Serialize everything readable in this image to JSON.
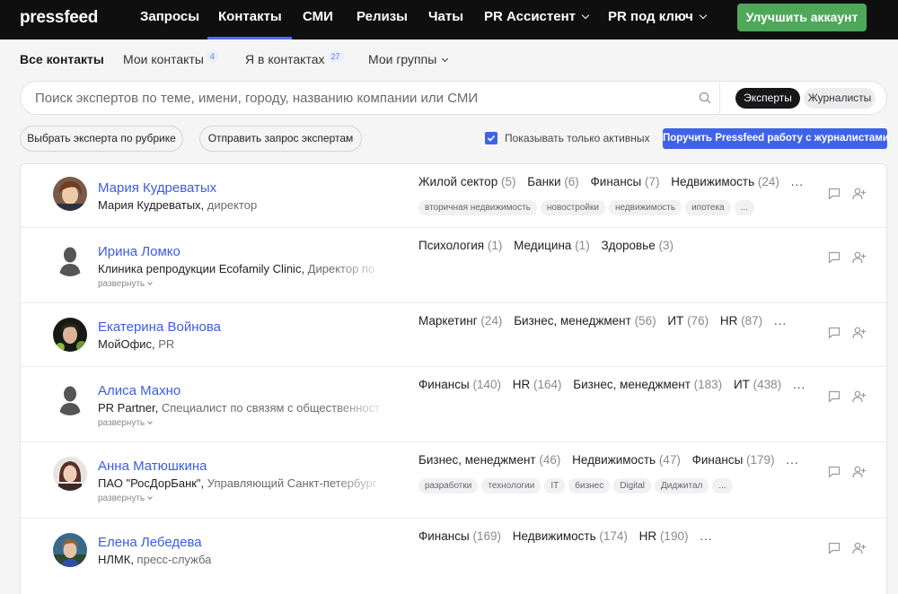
{
  "app": {
    "logo": "pressfeed",
    "nav": [
      {
        "label": "Запросы"
      },
      {
        "label": "Контакты"
      },
      {
        "label": "СМИ"
      },
      {
        "label": "Релизы"
      },
      {
        "label": "Чаты"
      },
      {
        "label": "PR Ассистент"
      },
      {
        "label": "PR под ключ"
      }
    ],
    "upgrade_label": "Улучшить аккаунт"
  },
  "subtabs": [
    {
      "label": "Все контакты",
      "count": ""
    },
    {
      "label": "Мои контакты",
      "count": "4"
    },
    {
      "label": "Я в контактах",
      "count": "27"
    },
    {
      "label": "Мои группы",
      "count": ""
    }
  ],
  "search": {
    "placeholder": "Поиск экспертов по теме, имени, городу, названию компании или СМИ",
    "toggle_on": "Эксперты",
    "toggle_off": "Журналисты"
  },
  "actions": {
    "by_rubric": "Выбрать эксперта по рубрике",
    "send_request": "Отправить запрос экспертам",
    "only_active": "Показывать только активных",
    "cta": "Поручить Pressfeed работу с журналистами"
  },
  "experts": [
    {
      "name": "Мария Кудреватых",
      "company": "Мария Кудреватых, ",
      "position": "директор",
      "expand": "",
      "categories": [
        {
          "label": "Жилой сектор",
          "n": "(5)"
        },
        {
          "label": "Банки",
          "n": "(6)"
        },
        {
          "label": "Финансы",
          "n": "(7)"
        },
        {
          "label": "Недвижимость",
          "n": "(24)"
        }
      ],
      "more": "...",
      "tags": [
        "вторичная недвижимость",
        "новостройки",
        "недвижимость",
        "ипотека",
        "..."
      ]
    },
    {
      "name": "Ирина Ломко",
      "company": "Клиника репродукции Ecofamily Clinic, ",
      "position": "Директор по",
      "expand": "развернуть",
      "categories": [
        {
          "label": "Психология",
          "n": "(1)"
        },
        {
          "label": "Медицина",
          "n": "(1)"
        },
        {
          "label": "Здоровье",
          "n": "(3)"
        }
      ],
      "more": "",
      "tags": []
    },
    {
      "name": "Екатерина Войнова",
      "company": "МойОфис, ",
      "position": "PR",
      "expand": "",
      "categories": [
        {
          "label": "Маркетинг",
          "n": "(24)"
        },
        {
          "label": "Бизнес, менеджмент",
          "n": "(56)"
        },
        {
          "label": "ИТ",
          "n": "(76)"
        },
        {
          "label": "HR",
          "n": "(87)"
        }
      ],
      "more": "...",
      "tags": []
    },
    {
      "name": "Алиса Махно",
      "company": "PR Partner, ",
      "position": "Специалист по связям с общественност",
      "expand": "развернуть",
      "categories": [
        {
          "label": "Финансы",
          "n": "(140)"
        },
        {
          "label": "HR",
          "n": "(164)"
        },
        {
          "label": "Бизнес, менеджмент",
          "n": "(183)"
        },
        {
          "label": "ИТ",
          "n": "(438)"
        }
      ],
      "more": "...",
      "tags": []
    },
    {
      "name": "Анна Матюшкина",
      "company": "ПАО \"РосДорБанк\", ",
      "position": "Управляющий Санкт-петербург",
      "expand": "развернуть",
      "categories": [
        {
          "label": "Бизнес, менеджмент",
          "n": "(46)"
        },
        {
          "label": "Недвижимость",
          "n": "(47)"
        },
        {
          "label": "Финансы",
          "n": "(179)"
        }
      ],
      "more": "...",
      "tags": [
        "разработки",
        "технологии",
        "IT",
        "бизнес",
        "Digital",
        "Диджитал",
        "..."
      ]
    },
    {
      "name": "Елена Лебедева",
      "company": "НЛМК, ",
      "position": "пресс-служба",
      "expand": "",
      "categories": [
        {
          "label": "Финансы",
          "n": "(169)"
        },
        {
          "label": "Недвижимость",
          "n": "(174)"
        },
        {
          "label": "HR",
          "n": "(190)"
        }
      ],
      "more": "...",
      "tags": []
    }
  ],
  "colors": {
    "accent": "#3f63e8",
    "upgrade": "#4fa85a",
    "topbar": "#0f0f10",
    "name": "#3c5de0"
  },
  "icons": [
    "search-icon",
    "chevron-down-icon",
    "checkmark-icon",
    "chat-icon",
    "add-contact-icon",
    "avatar-placeholder-icon"
  ]
}
